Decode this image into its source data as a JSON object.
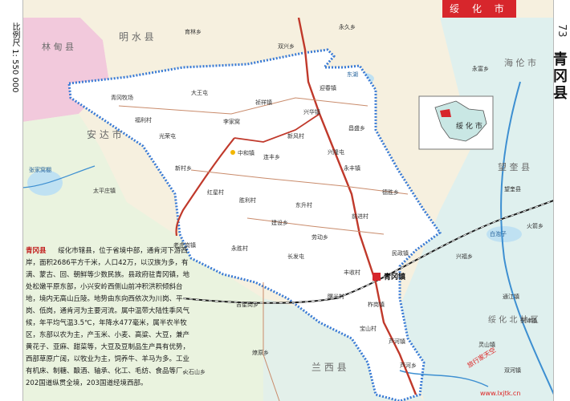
{
  "header": {
    "region_tag": "绥 化 市",
    "page_number": "73",
    "title": "青冈县",
    "scale": "比例尺 1: 550 000"
  },
  "legend_inset": {
    "label": "绥 化 市"
  },
  "neighbors": {
    "north": "明 水 县",
    "west": "林 甸 县",
    "east": "海 伦 市",
    "east2": "望 奎 县",
    "southwest": "安 达 市",
    "south": "兰 西 县",
    "southeast": "绥 化 北 林 区"
  },
  "description": {
    "title": "青冈县",
    "text": "绥化市辖县，位于省境中部，通肯河下游西岸，面积2686平方千米，人口42万，以汉族为多，有满、蒙古、回、朝鲜等少数民族。县政府驻青冈镇，地处松嫩平原东部，小兴安岭西侧山前冲积洪积倾斜台地，境内无高山丘陵。地势由东向西依次为川岗、平岗、低岗，通肯河为主要河流。属中温带大陆性季风气候，年平均气温3.5℃，年降水477毫米，属半农半牧区，东部以农为主，产玉米、小麦、高粱、大豆，兼产黄花子、亚麻、甜菜等，大豆及豆制品生产具有优势，西部草原广阔，以牧业为主，饲养牛、羊马为多。工业有机床、制糖、酿酒、轴承、化工、毛纺、食品等厂。202国道纵贯全境，203国道经境西部。"
  },
  "places": {
    "towns": [
      "青冈镇",
      "中和镇",
      "新村乡",
      "连丰乡",
      "永丰镇",
      "建设乡",
      "劳动乡",
      "民政镇",
      "祯祥镇",
      "德胜乡",
      "芦河镇",
      "兴华镇",
      "昌盛乡",
      "柞岗镇",
      "迎春镇",
      "芦河乡"
    ],
    "outside": [
      "太平庄镇",
      "老虎岗镇",
      "吉星岗乡",
      "火石山乡",
      "燎原乡",
      "双兴乡",
      "永久乡",
      "育林乡",
      "永富乡",
      "望奎县",
      "火箭乡",
      "通江镇",
      "东津镇",
      "兴福乡",
      "双河镇",
      "灵山镇"
    ],
    "villages": [
      "青冈牧场",
      "福利村",
      "光荣屯",
      "大王屯",
      "李家窝",
      "新风村",
      "兴隆屯",
      "红星村",
      "胜利村",
      "东升村",
      "前进村",
      "永胜村",
      "长发屯",
      "丰收村",
      "曙光村",
      "宝山村"
    ],
    "lakes": [
      "张家窝棚",
      "东湖",
      "白泡子"
    ]
  },
  "watermark": "旅行家天空",
  "watermark_url": "www.lxjtk.cn",
  "colors": {
    "county_fill": "#ffffff",
    "county_border": "#3a7bd5",
    "neighbor_fill": "#dff0ee",
    "neighbor_left_fill": "#f2c9dc",
    "land_fill": "#f6f0df",
    "rail": "#1a1a1a",
    "highway": "#c0392b",
    "river": "#3d8fd1",
    "road": "#c98b6b",
    "inset_fill": "#c9e7e4"
  }
}
